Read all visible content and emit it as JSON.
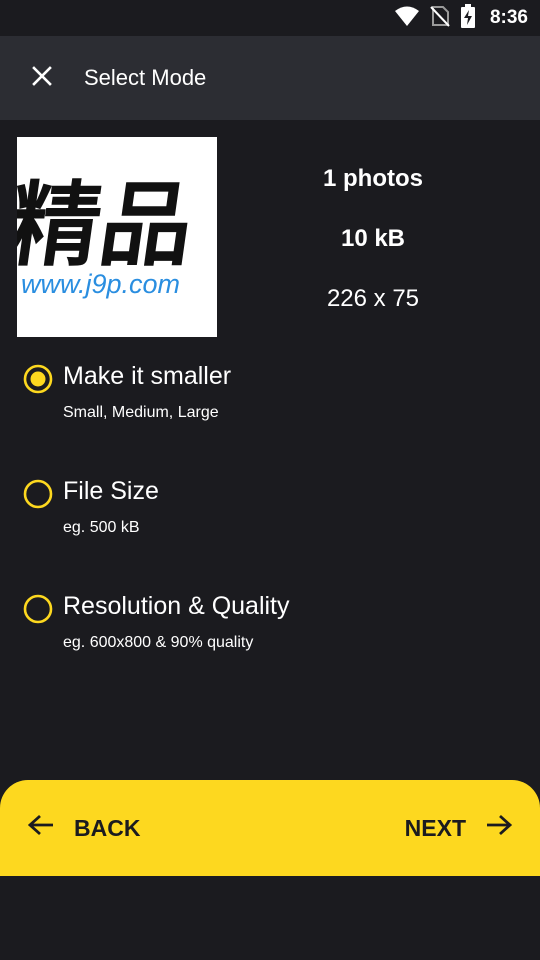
{
  "status_bar": {
    "time": "8:36",
    "icons": [
      "wifi-icon",
      "no-sim-icon",
      "battery-charging-icon"
    ]
  },
  "app_bar": {
    "title": "Select Mode",
    "close_icon": "close-icon"
  },
  "preview": {
    "thumbnail_text_main": "精品",
    "thumbnail_text_url": "www.j9p.com",
    "photo_count": "1 photos",
    "file_size": "10 kB",
    "dimensions": "226 x 75"
  },
  "options": [
    {
      "title": "Make it smaller",
      "subtitle": "Small, Medium, Large",
      "selected": true
    },
    {
      "title": "File Size",
      "subtitle": "eg. 500 kB",
      "selected": false
    },
    {
      "title": "Resolution & Quality",
      "subtitle": "eg. 600x800 & 90% quality",
      "selected": false
    }
  ],
  "bottom_bar": {
    "back_label": "BACK",
    "next_label": "NEXT"
  },
  "colors": {
    "accent": "#fdd81f",
    "background": "#1b1b1f",
    "app_bar": "#2c2d33",
    "logo_blue": "#2a8ee0"
  }
}
